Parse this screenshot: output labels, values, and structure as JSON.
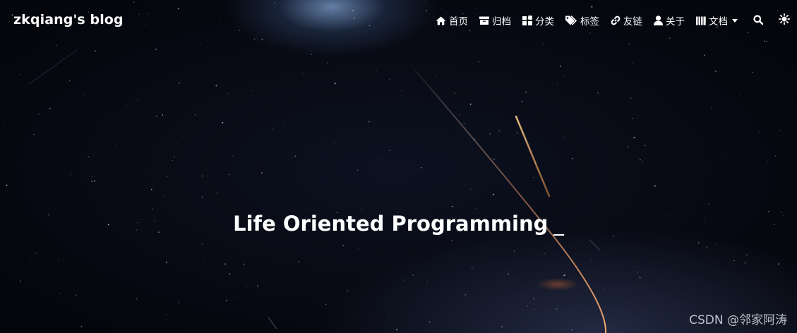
{
  "brand": {
    "title": "zkqiang's blog"
  },
  "nav": {
    "items": [
      {
        "label": "首页",
        "icon": "home-icon"
      },
      {
        "label": "归档",
        "icon": "archive-icon"
      },
      {
        "label": "分类",
        "icon": "categories-icon"
      },
      {
        "label": "标签",
        "icon": "tags-icon"
      },
      {
        "label": "友链",
        "icon": "link-icon"
      },
      {
        "label": "关于",
        "icon": "user-icon"
      },
      {
        "label": "文档",
        "icon": "docs-icon",
        "dropdown": true
      }
    ],
    "search_icon": "search-icon",
    "theme_icon": "sun-icon"
  },
  "hero": {
    "title": "Life Oriented Programming",
    "cursor": "_",
    "background": "night-sky-with-meteor-trails"
  },
  "watermark": {
    "text": "CSDN @邻家阿涛"
  },
  "colors": {
    "text": "#ffffff",
    "background": "#05070d",
    "meteor": "#e8a060"
  }
}
